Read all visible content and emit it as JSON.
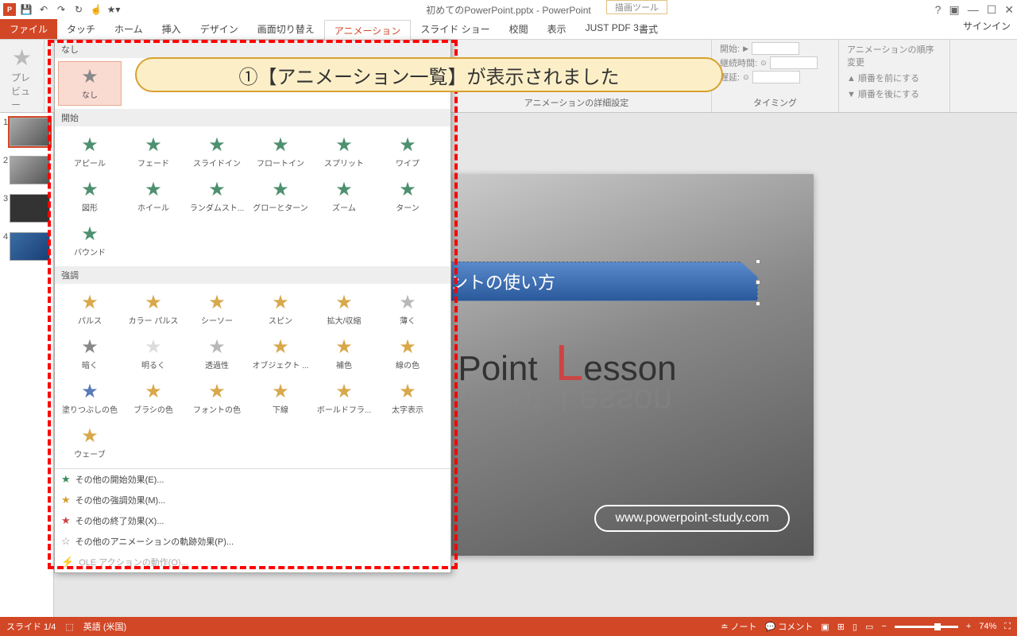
{
  "title": "初めてのPowerPoint.pptx - PowerPoint",
  "contextTab": "描画ツール",
  "contextSub": "書式",
  "signin": "サインイン",
  "tabs": [
    "ファイル",
    "タッチ",
    "ホーム",
    "挿入",
    "デザイン",
    "画面切り替え",
    "アニメーション",
    "スライド ショー",
    "校閲",
    "表示",
    "JUST PDF 3"
  ],
  "activeTab": 6,
  "ribbon": {
    "preview": "プレビュー",
    "previewGrp": "プレビュー",
    "advanced": "アニメーションの詳細設定",
    "start": "開始:",
    "duration": "継続時間:",
    "delay": "遅延:",
    "timing": "タイミング",
    "reorder": "アニメーションの順序変更",
    "moveUp": "順番を前にする",
    "moveDown": "順番を後にする"
  },
  "gallery": {
    "none": "なし",
    "noneItem": "なし",
    "entrance": "開始",
    "emphasis": "強調",
    "entranceItems": [
      "アピール",
      "フェード",
      "スライドイン",
      "フロートイン",
      "スプリット",
      "ワイプ",
      "図形",
      "ホイール",
      "ランダムスト...",
      "グローとターン",
      "ズーム",
      "ターン",
      "バウンド"
    ],
    "emphasisItems": [
      "パルス",
      "カラー パルス",
      "シーソー",
      "スピン",
      "拡大/収縮",
      "薄く",
      "暗く",
      "明るく",
      "透過性",
      "オブジェクト ...",
      "補色",
      "線の色",
      "塗りつぶしの色",
      "ブラシの色",
      "フォントの色",
      "下線",
      "ボールドフラ...",
      "太字表示",
      "ウェーブ"
    ],
    "moreEntrance": "その他の開始効果(E)...",
    "moreEmphasis": "その他の強調効果(M)...",
    "moreExit": "その他の終了効果(X)...",
    "moreMotion": "その他のアニメーションの軌跡効果(P)...",
    "oleAction": "OLE アクションの動作(O)..."
  },
  "slide": {
    "titleText": "銭パワーポイントの使い方",
    "logo1a": "P",
    "logo1b": "oint",
    "logo2a": "L",
    "logo2b": "esson",
    "url": "www.powerpoint-study.com"
  },
  "callout": "①【アニメーション一覧】が表示されました",
  "status": {
    "slide": "スライド 1/4",
    "lang": "英語 (米国)",
    "notes": "ノート",
    "comments": "コメント",
    "zoom": "74%"
  }
}
